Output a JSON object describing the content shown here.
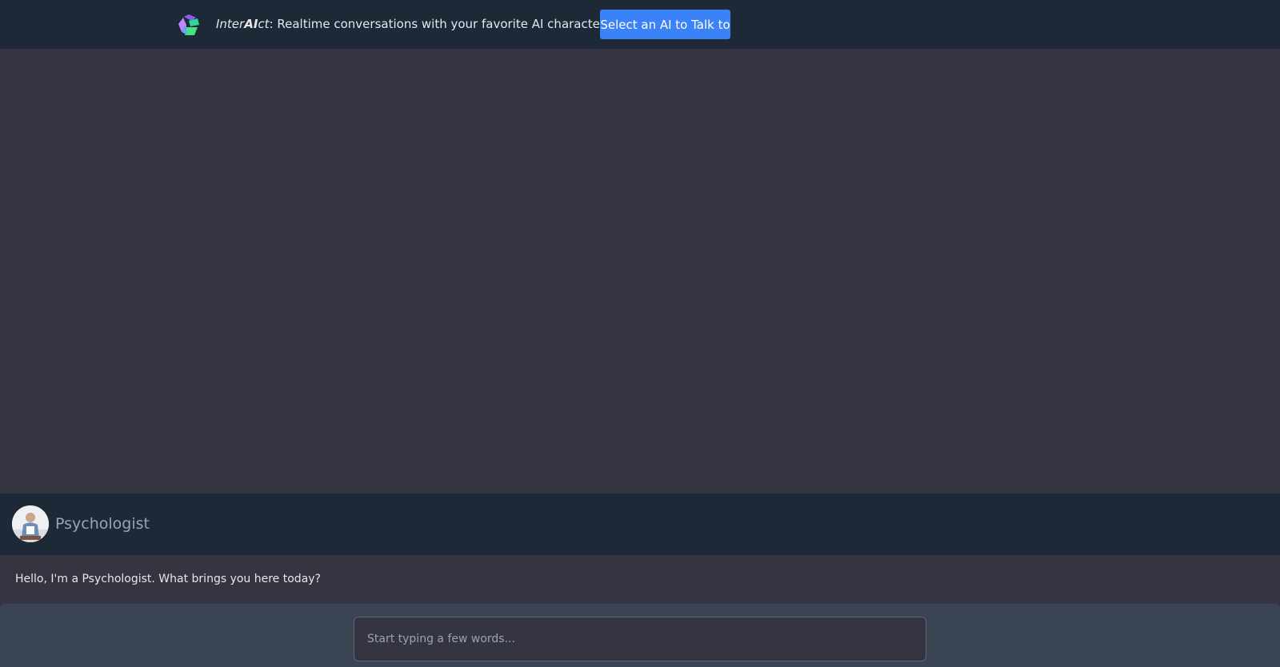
{
  "header": {
    "brand_prefix": "Inter",
    "brand_ai": "AI",
    "brand_suffix": "ct",
    "tagline": ": Realtime conversations with your favorite AI character",
    "select_button_label": "Select an AI to Talk to",
    "logo_icon": "cube-logo-icon"
  },
  "character": {
    "name": "Psychologist",
    "avatar_icon": "psychologist-avatar"
  },
  "messages": [
    {
      "text": "Hello, I'm a Psychologist. What brings you here today?"
    }
  ],
  "composer": {
    "placeholder": "Start typing a few words...",
    "value": ""
  },
  "colors": {
    "accent": "#3b82f6",
    "header_bg": "#1e2938",
    "page_bg": "#343541",
    "input_bar_bg": "#3a4453"
  }
}
